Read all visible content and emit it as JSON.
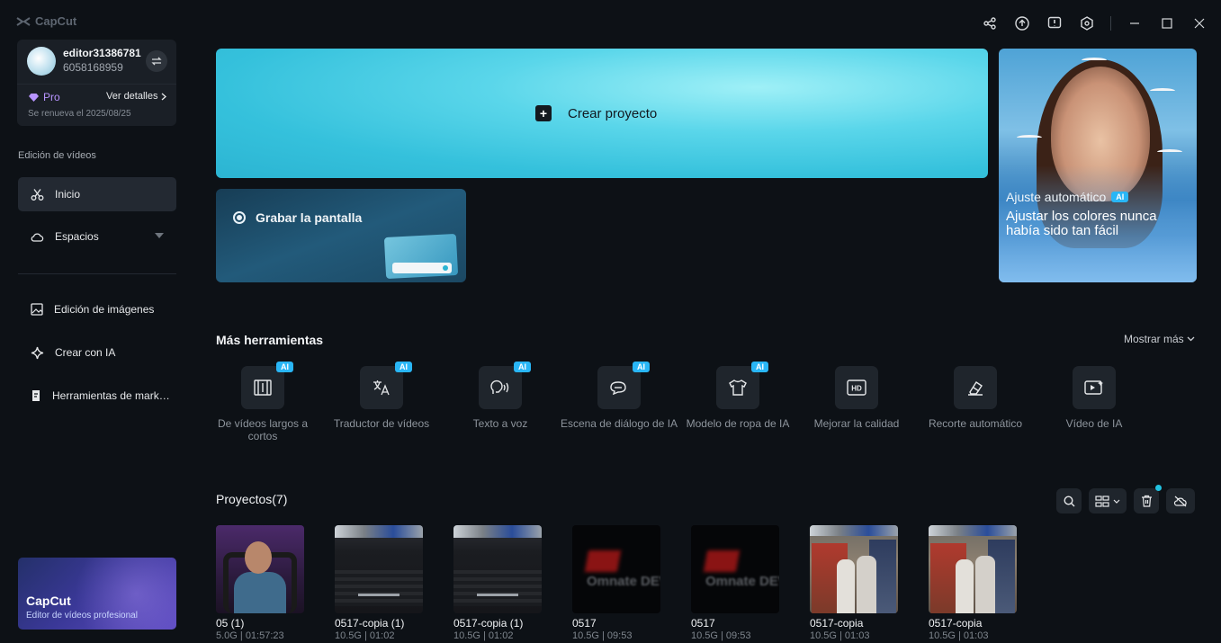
{
  "app": {
    "name": "CapCut"
  },
  "account": {
    "username": "editor31386781",
    "user_id": "6058168959",
    "plan": "Pro",
    "details_label": "Ver detalles",
    "renewal": "Se renueva el 2025/08/25"
  },
  "sidebar": {
    "section_label": "Edición de vídeos",
    "items": [
      {
        "label": "Inicio",
        "icon": "scissors-icon",
        "active": true
      },
      {
        "label": "Espacios",
        "icon": "cloud-icon"
      },
      {
        "label": "Edición de imágenes",
        "icon": "image-icon"
      },
      {
        "label": "Crear con IA",
        "icon": "sparkle-icon"
      },
      {
        "label": "Herramientas de mark…",
        "icon": "marketing-icon"
      }
    ],
    "promo": {
      "title": "CapCut",
      "subtitle": "Editor de vídeos profesional"
    }
  },
  "hero": {
    "create_label": "Crear proyecto"
  },
  "record": {
    "label": "Grabar la pantalla"
  },
  "banner": {
    "tag": "Ajuste automático",
    "badge": "AI",
    "headline": "Ajustar los colores nunca había sido tan fácil"
  },
  "tools": {
    "title": "Más herramientas",
    "show_more": "Mostrar más",
    "items": [
      {
        "label": "De vídeos largos a cortos",
        "ai": "AI",
        "icon": "film-cut-icon"
      },
      {
        "label": "Traductor de vídeos",
        "ai": "AI",
        "icon": "translate-icon"
      },
      {
        "label": "Texto a voz",
        "ai": "AI",
        "icon": "voice-icon"
      },
      {
        "label": "Escena de diálogo de IA",
        "ai": "AI",
        "icon": "dialogue-icon"
      },
      {
        "label": "Modelo de ropa de IA",
        "ai": "AI",
        "icon": "shirt-icon"
      },
      {
        "label": "Mejorar la calidad",
        "icon": "hd-icon"
      },
      {
        "label": "Recorte automático",
        "icon": "eraser-icon"
      },
      {
        "label": "Vídeo de IA",
        "icon": "ai-video-icon"
      }
    ]
  },
  "projects": {
    "title": "Proyectos(7)",
    "items": [
      {
        "name": "05 (1)",
        "meta": "5.0G | 01:57:23",
        "thumb": "person"
      },
      {
        "name": "0517-copia (1)",
        "meta": "10.5G | 01:02",
        "thumb": "game"
      },
      {
        "name": "0517-copia (1)",
        "meta": "10.5G | 01:02",
        "thumb": "game"
      },
      {
        "name": "0517",
        "meta": "10.5G | 09:53",
        "thumb": "dark"
      },
      {
        "name": "0517",
        "meta": "10.5G | 09:53",
        "thumb": "dark"
      },
      {
        "name": "0517-copia",
        "meta": "10.5G | 01:03",
        "thumb": "street"
      },
      {
        "name": "0517-copia",
        "meta": "10.5G | 01:03",
        "thumb": "street"
      }
    ],
    "dark_thumb_text": "Omnate DEV"
  },
  "colors": {
    "accent": "#29b6f6",
    "hero": "#35c1dc",
    "pro": "#b794ff",
    "bg": "#0d1116"
  }
}
